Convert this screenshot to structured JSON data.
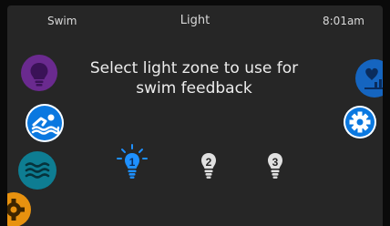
{
  "header": {
    "left_label": "Swim",
    "title": "Light",
    "time": "8:01am"
  },
  "main": {
    "message": "Select light zone to use for swim feedback"
  },
  "left_nav": [
    {
      "icon": "lightbulb-icon",
      "color": "#6a2a8f"
    },
    {
      "icon": "swimmer-icon",
      "color": "#0a78e0"
    },
    {
      "icon": "water-waves-icon",
      "color": "#0e7d92"
    },
    {
      "icon": "gear-icon",
      "color": "#e8920f"
    }
  ],
  "right_nav": [
    {
      "icon": "chart-heart-icon",
      "color": "#1565c0"
    },
    {
      "icon": "gear-icon",
      "color": "#0a78e0"
    }
  ],
  "zones": [
    {
      "label": "1",
      "selected": true,
      "color": "#1e90ff"
    },
    {
      "label": "2",
      "selected": false,
      "color": "#e0e0e0"
    },
    {
      "label": "3",
      "selected": false,
      "color": "#e0e0e0"
    }
  ]
}
